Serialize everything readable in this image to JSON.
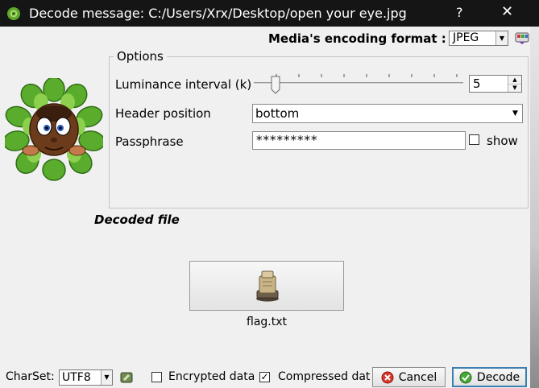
{
  "window": {
    "title": "Decode message: C:/Users/Xrx/Desktop/open your eye.jpg",
    "help_glyph": "?",
    "close_glyph": "✕"
  },
  "media": {
    "label": "Media's encoding format :",
    "format": "JPEG"
  },
  "options": {
    "legend": "Options",
    "luminance_label": "Luminance interval (k)",
    "luminance_value": "5",
    "header_label": "Header position",
    "header_value": "bottom",
    "passphrase_label": "Passphrase",
    "passphrase_value": "*********",
    "show_label": "show",
    "show_checked": false
  },
  "decoded": {
    "label": "Decoded file",
    "file_name": "flag.txt"
  },
  "bottom": {
    "charset_label": "CharSet:",
    "charset_value": "UTF8",
    "encrypted_label": "Encrypted data",
    "encrypted_checked": false,
    "compressed_label": "Compressed dat",
    "compressed_checked": true,
    "cancel_label": "Cancel",
    "decode_label": "Decode"
  },
  "icons": {
    "app": "leaf-app-icon",
    "media_format": "palette-icon",
    "mascot": "leaf-mascot-icon",
    "file": "archive-file-icon",
    "charset": "charset-edit-icon",
    "cancel": "cancel-icon",
    "decode": "checkmark-icon"
  },
  "colors": {
    "titlebar": "#151515",
    "window_bg": "#f0f0f0",
    "leaf_green": "#55a82a",
    "cancel_red": "#d8372a",
    "decode_green": "#49a83a",
    "focus_border": "#3c7fb1"
  }
}
